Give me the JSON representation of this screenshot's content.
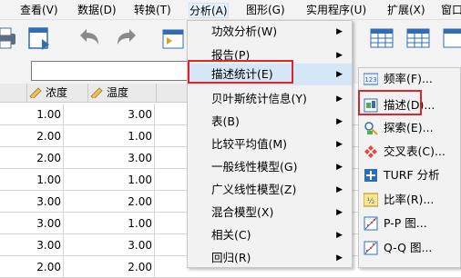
{
  "menubar": {
    "items": [
      "查看(V)",
      "数据(D)",
      "转换(T)",
      "分析(A)",
      "图形(G)",
      "实用程序(U)",
      "扩展(X)",
      "窗口"
    ]
  },
  "columns": [
    {
      "name": "浓度"
    },
    {
      "name": "温度"
    }
  ],
  "rows": [
    [
      "1.00",
      "3.00"
    ],
    [
      "2.00",
      "1.00"
    ],
    [
      "2.00",
      "3.00"
    ],
    [
      "1.00",
      "1.00"
    ],
    [
      "3.00",
      "2.00"
    ],
    [
      "3.00",
      "1.00"
    ],
    [
      "3.00",
      "3.00"
    ],
    [
      "2.00",
      "2.00"
    ]
  ],
  "analyze_menu": {
    "items": [
      {
        "label": "功效分析(W)",
        "submenu": true
      },
      {
        "label": "报告(P)",
        "submenu": true
      },
      {
        "label": "描述统计(E)",
        "submenu": true
      },
      {
        "label": "贝叶斯统计信息(Y)",
        "submenu": true
      },
      {
        "label": "表(B)",
        "submenu": true
      },
      {
        "label": "比较平均值(M)",
        "submenu": true
      },
      {
        "label": "一般线性模型(G)",
        "submenu": true
      },
      {
        "label": "广义线性模型(Z)",
        "submenu": true
      },
      {
        "label": "混合模型(X)",
        "submenu": true
      },
      {
        "label": "相关(C)",
        "submenu": true
      },
      {
        "label": "回归(R)",
        "submenu": true
      }
    ],
    "highlighted": "描述统计(E)",
    "arrow_glyph": "▶"
  },
  "descriptives_submenu": {
    "items": [
      {
        "label": "频率(F)...",
        "icon": "frequencies-icon"
      },
      {
        "label": "描述(D)...",
        "icon": "descriptives-icon"
      },
      {
        "label": "探索(E)...",
        "icon": "explore-icon"
      },
      {
        "label": "交叉表(C)...",
        "icon": "crosstabs-icon"
      },
      {
        "label": "TURF 分析",
        "icon": "turf-icon"
      },
      {
        "label": "比率(R)...",
        "icon": "ratio-icon"
      },
      {
        "label": "P-P 图...",
        "icon": "pp-plot-icon"
      },
      {
        "label": "Q-Q 图...",
        "icon": "qq-plot-icon"
      }
    ],
    "highlighted": "描述(D)..."
  },
  "colors": {
    "highlight_box": "#e0252a",
    "menu_hover": "#d5e6f6",
    "menu_bg": "#f2f2f2"
  }
}
